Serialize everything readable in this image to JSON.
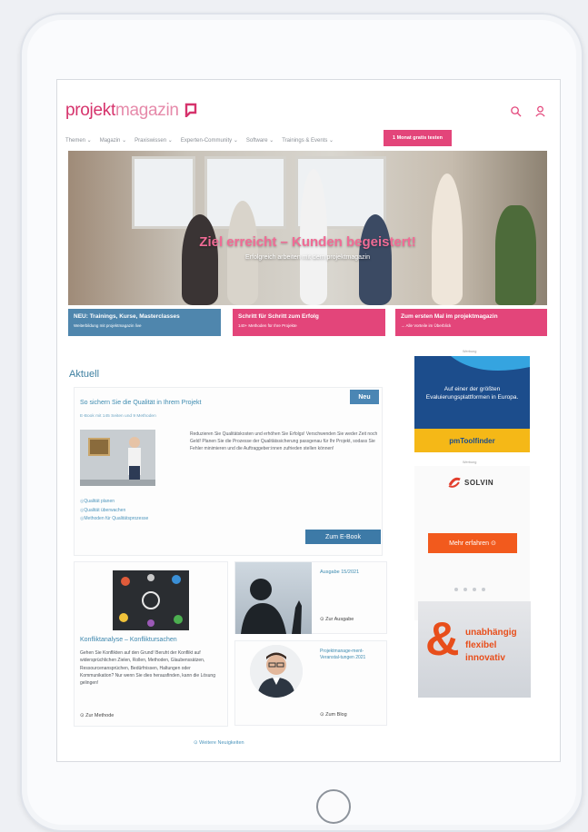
{
  "header": {
    "logo_part1": "projekt",
    "logo_part2": "magazin",
    "nav": [
      "Themen ⌄",
      "Magazin ⌄",
      "Praxiswissen ⌄",
      "Experten-Community ⌄",
      "Software ⌄",
      "Trainings & Events ⌄"
    ],
    "cta": "1 Monat gratis testen"
  },
  "hero": {
    "title": "Ziel erreicht – Kunden begeistert!",
    "subtitle": "Erfolgreich arbeiten mit dem projektmagazin"
  },
  "teasers": [
    {
      "title": "NEU: Trainings, Kurse, Masterclasses",
      "sub": "Weiterbildung mit projektmagazin live",
      "color": "#4f86ad"
    },
    {
      "title": "Schritt für Schritt zum Erfolg",
      "sub": "140+ Methoden für Ihre Projekte",
      "color": "#e3457a"
    },
    {
      "title": "Zum ersten Mal im projektmagazin",
      "sub": "→ Alle Vorteile im Überblick",
      "color": "#e3457a"
    }
  ],
  "main": {
    "section_title": "Aktuell",
    "featured": {
      "title": "So sichern Sie die Qualität in Ihrem Projekt",
      "meta": "E-Book mit 145 Seiten und 9 Methoden",
      "badge": "Neu",
      "text": "Reduzieren Sie Qualitätskosten und erhöhen Sie Erfolgs! Verschwenden Sie weder Zeit noch Geld! Planen Sie die Prozesse der Qualitätssicherung passgenau für Ihr Projekt, sodass Sie Fehler minimieren und die Auftraggeber:innen zufrieden stellen können!",
      "links": [
        "Qualität planen",
        "Qualität überwachen",
        "Methoden für Qualitätsprozesse"
      ],
      "button": "Zum E-Book"
    },
    "method": {
      "title": "Konfliktanalyse – Konfliktursachen",
      "text": "Gehen Sie Konflikten auf den Grund! Beruht der Konflikt auf widersprüchlichen Zielen, Rollen, Methoden, Glaubenssätzen, Ressourcenansprüchen, Bedürfnissen, Haltungen oder Kommunikation? Nur wenn Sie dies herausfinden, kann die Lösung gelingen!",
      "link": "⊙ Zur Methode"
    },
    "issue": {
      "label": "Ausgabe 15/2021",
      "link": "⊙ Zur Ausgabe"
    },
    "blog": {
      "label": "Projektmanage-ment-Veranstal-tungen 2021",
      "link": "⊙ Zum Blog"
    },
    "more": "⊙ Weitere Neuigkeiten"
  },
  "sidebar": {
    "ad_label": "Werbung",
    "ad1_text": "Auf einer der größten Evaluierungsplattformen in Europa.",
    "ad1_brand": "pmToolfinder",
    "ad2_brand": "SOLVIN",
    "ad2_button": "Mehr erfahren ⊙",
    "ad3_words": [
      "unabhängig",
      "flexibel",
      "innovativ"
    ]
  },
  "colors": {
    "brand": "#e3457a",
    "accent_blue": "#3d7aa7"
  }
}
